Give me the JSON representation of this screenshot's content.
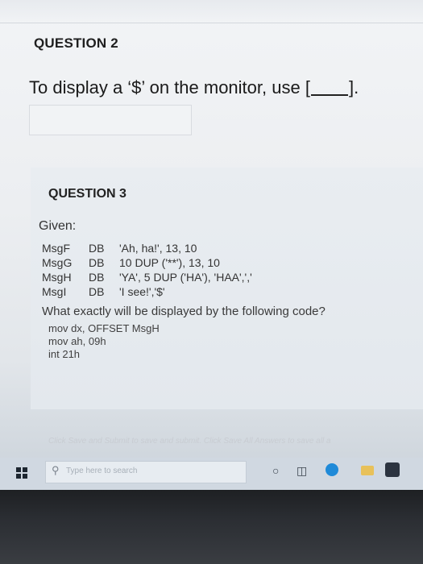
{
  "question2": {
    "title": "QUESTION 2",
    "text_before": "To display a ‘$’ on the monitor, use [",
    "text_after": "].",
    "answer_value": ""
  },
  "question3": {
    "title": "QUESTION 3",
    "given_label": "Given:",
    "code_lines": [
      {
        "label": "MsgF",
        "directive": "DB",
        "value": "'Ah, ha!', 13, 10"
      },
      {
        "label": "MsgG",
        "directive": "DB",
        "value": "10 DUP ('**'), 13, 10"
      },
      {
        "label": "MsgH",
        "directive": "DB",
        "value": "'YA', 5 DUP ('HA'), 'HAA',','"
      },
      {
        "label": "MsgI",
        "directive": "DB",
        "value": "'I see!','$'"
      }
    ],
    "question": "What exactly will be displayed by the following code?",
    "asm_lines": [
      "mov dx, OFFSET MsgH",
      "mov ah, 09h",
      "int 21h"
    ]
  },
  "footer": {
    "note": "Click Save and Submit to save and submit. Click Save All Answers to save all a"
  },
  "taskbar": {
    "search_placeholder": "Type here to search"
  }
}
